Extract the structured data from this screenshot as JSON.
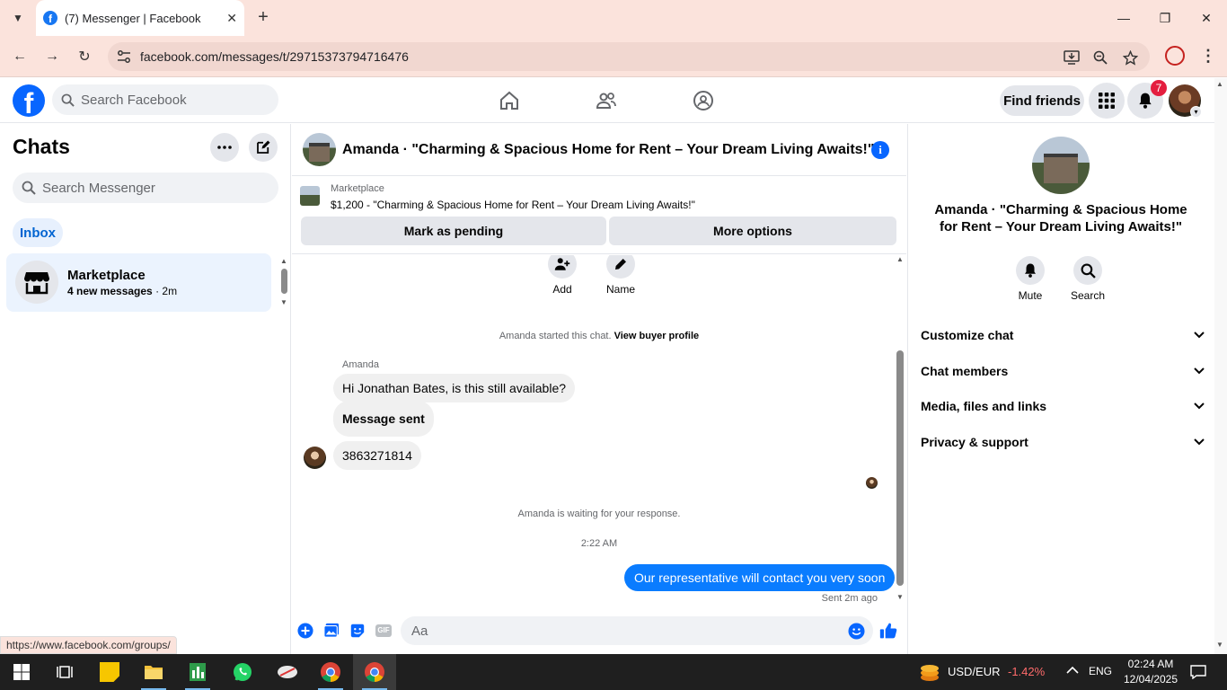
{
  "browser": {
    "tab_title": "(7) Messenger | Facebook",
    "url": "facebook.com/messages/t/29715373794716476",
    "status_url": "https://www.facebook.com/groups/"
  },
  "facebook": {
    "search_placeholder": "Search Facebook",
    "find_friends": "Find friends",
    "notification_count": "7"
  },
  "left": {
    "title": "Chats",
    "search_placeholder": "Search Messenger",
    "inbox_label": "Inbox",
    "chats": [
      {
        "name": "Marketplace",
        "preview": "4 new messages",
        "time": "· 2m"
      }
    ]
  },
  "conversation": {
    "title": "Amanda · \"Charming & Spacious Home for Rent – Your Dream Living Awaits!\"",
    "marketplace_label": "Marketplace",
    "listing": "$1,200 - \"Charming & Spacious Home for Rent – Your Dream Living Awaits!\"",
    "mark_pending": "Mark as pending",
    "more_options": "More options",
    "actions": [
      {
        "label": "Add"
      },
      {
        "label": "Name"
      }
    ],
    "started_text": "Amanda started this chat.",
    "view_profile": "View buyer profile",
    "sender_name": "Amanda",
    "messages_in": [
      "Hi Jonathan Bates, is this still available?",
      "Message sent",
      "3863271814"
    ],
    "waiting_text": "Amanda is waiting for your response.",
    "timestamp": "2:22 AM",
    "message_out": "Our representative will contact you very soon",
    "sent_status": "Sent 2m ago",
    "composer_placeholder": "Aa"
  },
  "right_panel": {
    "title": "Amanda · \"Charming & Spacious Home for Rent – Your Dream Living Awaits!\"",
    "actions": [
      {
        "label": "Mute"
      },
      {
        "label": "Search"
      }
    ],
    "sections": [
      "Customize chat",
      "Chat members",
      "Media, files and links",
      "Privacy & support"
    ]
  },
  "taskbar": {
    "currency": "USD/EUR",
    "change": "-1.42%",
    "lang": "ENG",
    "time": "02:24 AM",
    "date": "12/04/2025"
  },
  "colors": {
    "accent": "#0866ff",
    "outgoing_bubble": "#0a7cff",
    "chrome": "#fbe3dc",
    "negative": "#ff6b6b"
  }
}
